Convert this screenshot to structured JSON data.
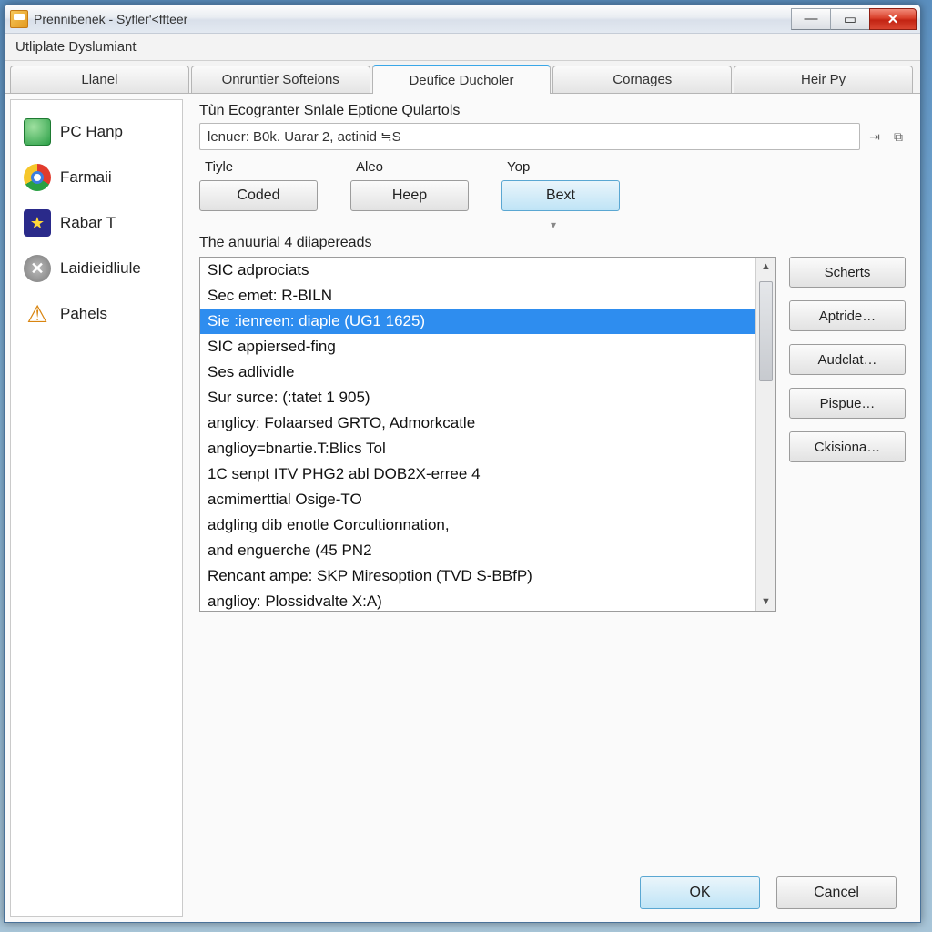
{
  "titlebar": {
    "title": "Prennibenek - Syfler'<ffteer "
  },
  "subtitle": "Utliplate Dyslumiant",
  "tabs": [
    {
      "label": "Llanel",
      "active": false
    },
    {
      "label": "Onruntier Softeions",
      "active": false
    },
    {
      "label": "Deüfice Ducholer",
      "active": true
    },
    {
      "label": "Cornages",
      "active": false
    },
    {
      "label": "Heir Py",
      "active": false
    }
  ],
  "sidebar": {
    "items": [
      {
        "label": "PC Hanp",
        "icon": "globe"
      },
      {
        "label": "Farmaii",
        "icon": "chrome"
      },
      {
        "label": "Rabar T",
        "icon": "star"
      },
      {
        "label": "Laidieidliule",
        "icon": "x"
      },
      {
        "label": "Pahels",
        "icon": "warn"
      }
    ]
  },
  "main": {
    "group_title": "Tùn Ecogranter Snlale Eptione Qulartols",
    "path_value": "lenuer: B0k. Uarar 2, actinid ≒S",
    "columns": [
      {
        "label": "Tiyle",
        "button": "Coded"
      },
      {
        "label": "Aleo",
        "button": "Heep"
      },
      {
        "label": "Yop",
        "button": "Bext"
      }
    ],
    "list_title": "The anuurial 4 diiapereads",
    "list_items": [
      "SIC adprociats",
      "Sec emet: R-BILN",
      "Sie :ienreen: diaple (UG1 1625)",
      "SIC appiersed-fing",
      "Ses adlividle",
      "Sur surce: (:tatet 1 905)",
      "anglicy: Folaarsed GRTO, Admorkcatle",
      "anglioy=bnartie.T:Blics Tol",
      "1C senpt ITV PHG2 abl DOB2X-erree 4",
      "acmimerttial Osige-TO",
      "adgling dib enotle Corcultionnation,",
      "and enguerche (45 PN2",
      "Rencant ampe: SKP Miresoption (TVD S-BBfP)",
      "anglioy: Plossidvalte X:A)"
    ],
    "selected_index": 2,
    "side_buttons": [
      "Scherts",
      "Aptride…",
      "Audclat…",
      "Pispue…",
      "Ckisiona…"
    ]
  },
  "dialog": {
    "ok": "OK",
    "cancel": "Cancel"
  }
}
